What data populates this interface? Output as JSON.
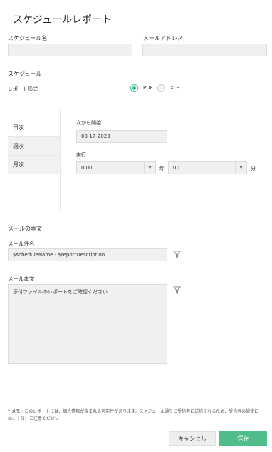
{
  "title": "スケジュールレポート",
  "schedule_name": {
    "label": "スケジュール名",
    "value": ""
  },
  "email_address": {
    "label": "メールアドレス",
    "value": ""
  },
  "schedule_section": "スケジュール",
  "report_format": {
    "label": "レポート形式",
    "options": [
      "PDF",
      "XLS"
    ],
    "selected": "PDF"
  },
  "frequency_tabs": [
    "日次",
    "週次",
    "月次"
  ],
  "start_from": {
    "label": "次から開始",
    "value": "03-17-2023"
  },
  "run": {
    "label": "実行",
    "hour_value": "0.00",
    "hour_unit": "時",
    "minute_value": "00",
    "minute_unit": "分"
  },
  "mail_body_section": "メールの本文",
  "subject": {
    "label": "メール件名",
    "value": "$scheduleName - $reportDescription"
  },
  "body": {
    "label": "メール本文",
    "value": "添付ファイルのレポートをご確認ください"
  },
  "note": {
    "prefix": "* メモ：",
    "text": "このレポートには、個人情報が含まれる可能性があります。スケジュール通りに受信者に送信されるため、受信者の設定には、十分、ご注意ください"
  },
  "buttons": {
    "cancel": "キャンセル",
    "save": "保存"
  },
  "colors": {
    "accent": "#4fbd8a",
    "radio_selected": "#40b885"
  }
}
